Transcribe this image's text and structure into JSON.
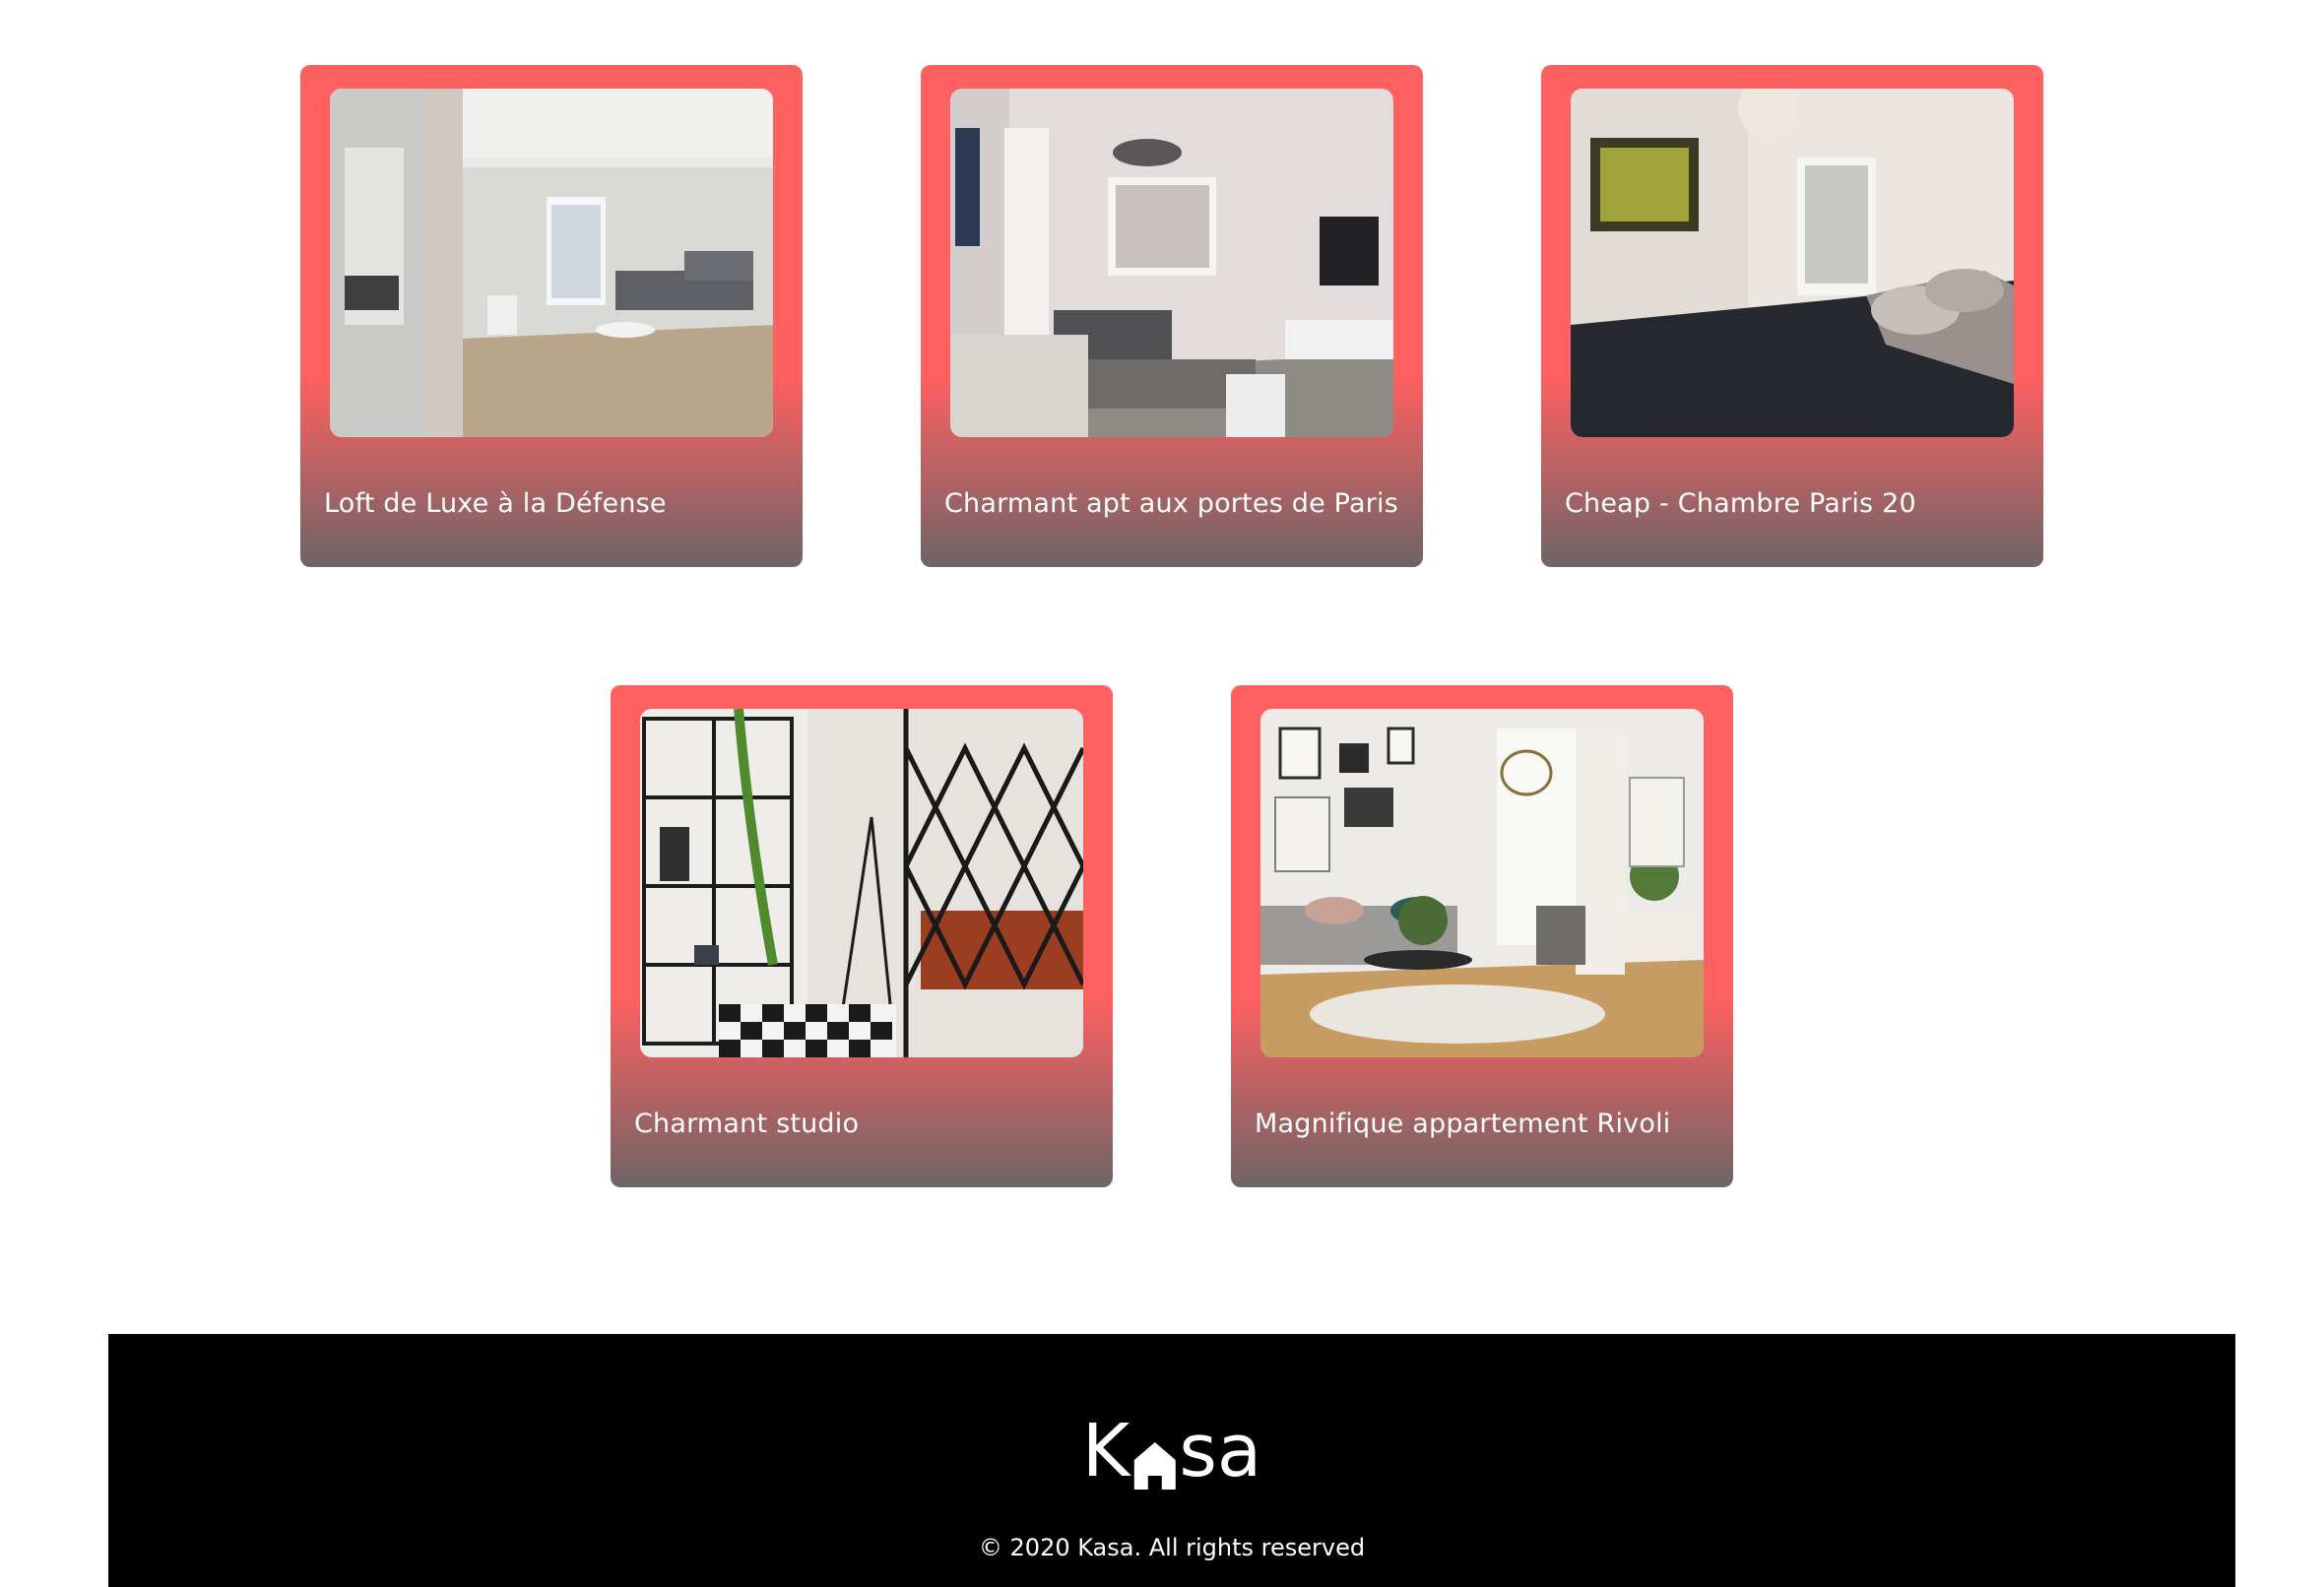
{
  "listings": [
    {
      "title": "Loft de Luxe à la Défense",
      "image": "photo-modern-loft-living-room"
    },
    {
      "title": "Charmant apt aux portes de Paris",
      "image": "photo-living-room-sofa-tv"
    },
    {
      "title": "Cheap - Chambre Paris 20",
      "image": "photo-bedroom-dark-bed"
    },
    {
      "title": "Charmant studio",
      "image": "photo-studio-shelves-lattice"
    },
    {
      "title": "Magnifique appartement Rivoli",
      "image": "photo-bright-living-room-art"
    }
  ],
  "footer": {
    "logo_left": "K",
    "logo_right": "sa",
    "copyright": "© 2020 Kasa. All rights reserved"
  },
  "colors": {
    "card_red": "#FF6060",
    "card_bottom": "#6e6466",
    "footer_bg": "#000000",
    "text": "#FFFFFF"
  }
}
